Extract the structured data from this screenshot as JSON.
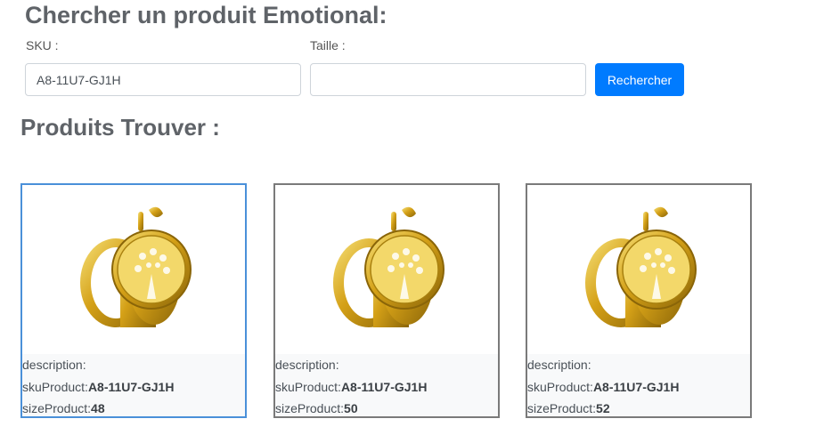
{
  "search": {
    "title": "Chercher un produit Emotional:",
    "sku_label": "SKU :",
    "sku_value": "A8-11U7-GJ1H",
    "size_label": "Taille :",
    "size_value": "",
    "button_label": "Rechercher"
  },
  "results": {
    "title": "Produits Trouver :",
    "description_label": "description:",
    "sku_label": "skuProduct:",
    "size_label": "sizeProduct:",
    "items": [
      {
        "sku": "A8-11U7-GJ1H",
        "size": "48",
        "selected": true
      },
      {
        "sku": "A8-11U7-GJ1H",
        "size": "50",
        "selected": false
      },
      {
        "sku": "A8-11U7-GJ1H",
        "size": "52",
        "selected": false
      }
    ]
  },
  "colors": {
    "primary": "#007bff",
    "selected_border": "#4a90d9",
    "card_border": "#7a7a7a",
    "gold": "#d4a017"
  },
  "icons": {
    "product_image": "gold-ring-tree-of-life-pendant"
  }
}
